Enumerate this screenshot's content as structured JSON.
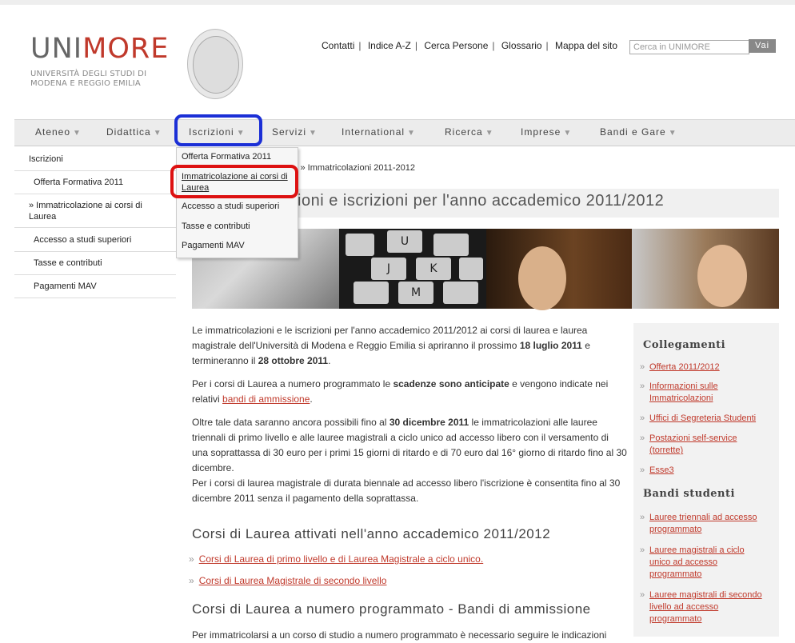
{
  "logo": {
    "part1": "UNI",
    "part2": "MORE",
    "sub1": "UNIVERSITÀ DEGLI STUDI DI",
    "sub2": "MODENA E REGGIO EMILIA"
  },
  "top_links": [
    "Contatti",
    "Indice A-Z",
    "Cerca Persone",
    "Glossario",
    "Mappa del sito"
  ],
  "search": {
    "placeholder": "Cerca in UNIMORE",
    "button": "Vai"
  },
  "nav": [
    "Ateneo",
    "Didattica",
    "Iscrizioni",
    "Servizi",
    "International",
    "Ricerca",
    "Imprese",
    "Bandi e Gare"
  ],
  "sidebar": [
    {
      "label": "Iscrizioni"
    },
    {
      "label": "Offerta Formativa 2011"
    },
    {
      "label": "»   Immatricolazione ai corsi di Laurea"
    },
    {
      "label": "Accesso a studi superiori"
    },
    {
      "label": "Tasse e contributi"
    },
    {
      "label": "Pagamenti MAV"
    }
  ],
  "dropdown": [
    "Offerta Formativa 2011",
    "Immatricolazione ai corsi di Laurea",
    "Accesso a studi superiori",
    "Tasse e contributi",
    "Pagamenti MAV"
  ],
  "breadcrumb": "i » Immatricolazioni 2011-2012",
  "page_title": "ioni e iscrizioni per l'anno accademico 2011/2012",
  "banner_keys": [
    "U",
    "J",
    "K",
    "M"
  ],
  "content": {
    "p1_a": "Le immatricolazioni e le iscrizioni per l'anno accademico 2011/2012 ai corsi di laurea e laurea magistrale dell'Università di Modena e Reggio Emilia si apriranno il prossimo ",
    "p1_b": "18 luglio 2011",
    "p1_c": " e termineranno il ",
    "p1_d": "28 ottobre 2011",
    "p1_e": ".",
    "p2_a": "Per i corsi di Laurea a numero programmato le ",
    "p2_b": "scadenze sono anticipate",
    "p2_c": " e vengono indicate nei relativi ",
    "p2_link": "bandi di ammissione",
    "p2_d": ".",
    "p3_a": "Oltre tale data saranno ancora possibili fino al ",
    "p3_b": "30 dicembre 2011",
    "p3_c": " le immatricolazioni alle lauree triennali di primo livello e alle lauree magistrali a ciclo unico ad accesso libero con il versamento di una soprattassa di 30 euro per i primi 15 giorni di ritardo e di 70 euro dal 16° giorno di ritardo fino al 30 dicembre.",
    "p4": "Per i corsi di laurea magistrale di durata biennale ad accesso libero l'iscrizione è consentita fino al 30 dicembre 2011 senza il pagamento della soprattassa.",
    "h2_1": "Corsi di Laurea attivati nell'anno accademico 2011/2012",
    "link1": "Corsi di Laurea di primo livello e di Laurea Magistrale a ciclo unico.",
    "link2": "Corsi di Laurea Magistrale di secondo livello",
    "h2_2": "Corsi di Laurea a numero programmato - Bandi di ammissione",
    "p5": "Per immatricolarsi a un corso di studio a numero programmato è necessario seguire le indicazioni"
  },
  "right": {
    "head1": "Collegamenti",
    "links1": [
      "Offerta 2011/2012",
      "Informazioni sulle Immatricolazioni",
      "Uffici di Segreteria Studenti",
      "Postazioni self-service (torrette)",
      "Esse3"
    ],
    "head2": "Bandi studenti",
    "links2": [
      "Lauree triennali ad accesso programmato",
      "Lauree magistrali a ciclo unico ad accesso programmato",
      "Lauree magistrali di secondo livello ad accesso programmato"
    ]
  },
  "colors": {
    "accent_red": "#c0392b",
    "highlight_blue": "#1b2fd6",
    "highlight_red": "#dd1111"
  }
}
